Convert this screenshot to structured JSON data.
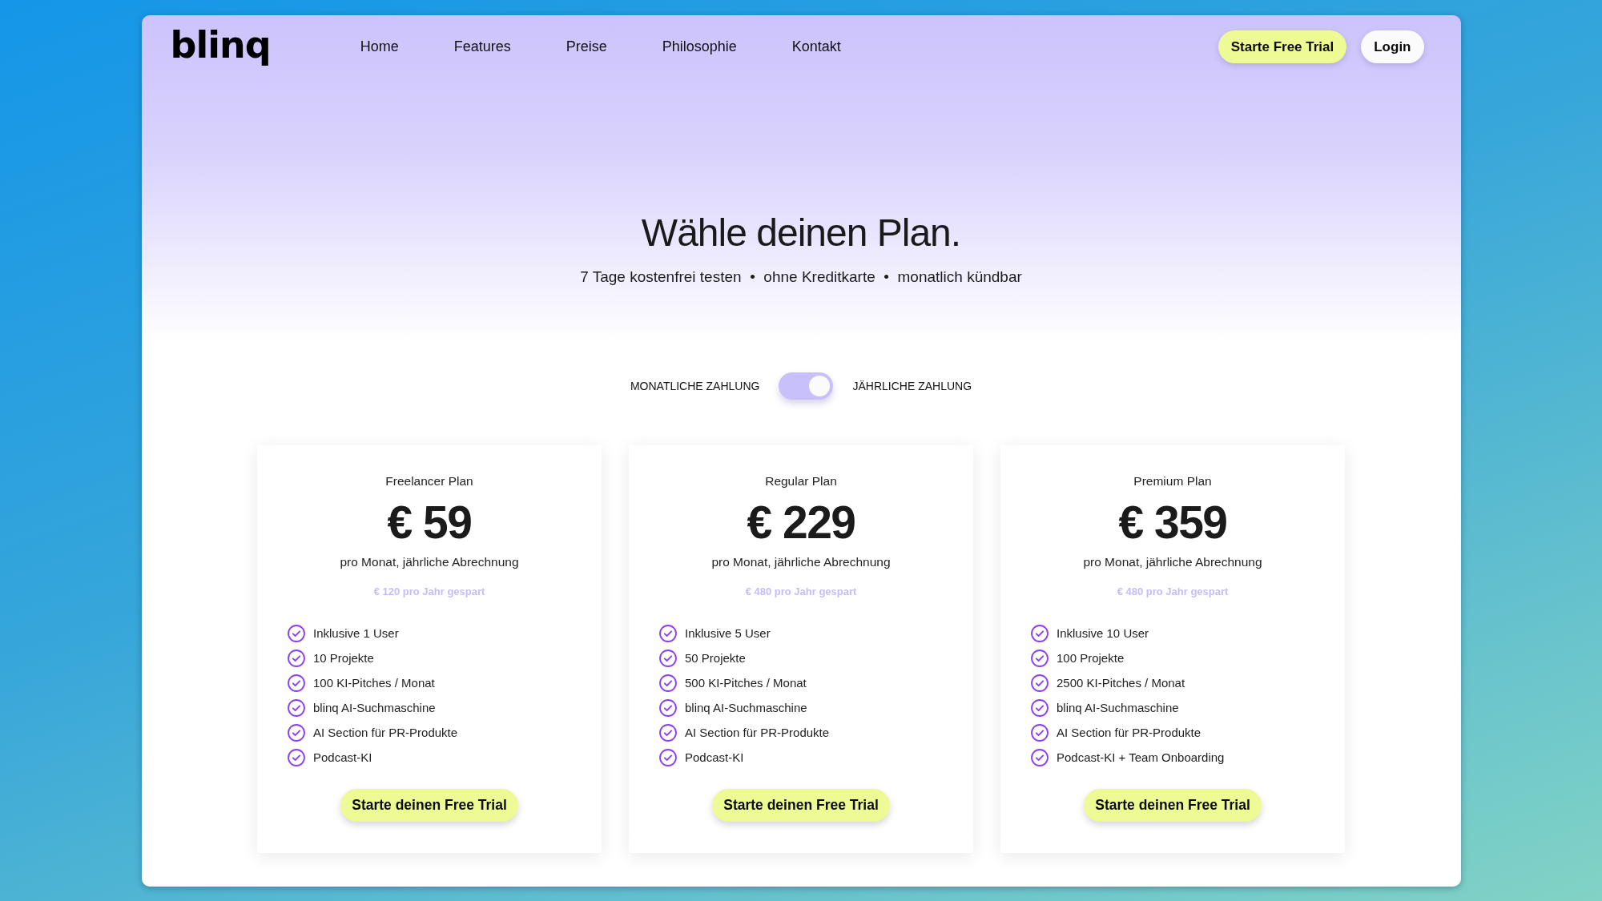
{
  "header": {
    "logo": "blinq",
    "nav": [
      {
        "label": "Home"
      },
      {
        "label": "Features"
      },
      {
        "label": "Preise"
      },
      {
        "label": "Philosophie"
      },
      {
        "label": "Kontakt"
      }
    ],
    "actions": [
      {
        "label": "Starte Free Trial",
        "kind": "primary"
      },
      {
        "label": "Login",
        "kind": "secondary"
      }
    ]
  },
  "hero": {
    "title": "Wähle deinen Plan.",
    "subtitle": "7 Tage kostenfrei testen  •  ohne Kreditkarte  •  monatlich kündbar"
  },
  "billing_toggle": {
    "left_label": "MONATLICHE ZAHLUNG",
    "right_label": "JÄHRLICHE ZAHLUNG",
    "on": true
  },
  "plans": [
    {
      "name": "Freelancer Plan",
      "price": "€ 59",
      "billing_note": "pro Monat, jährliche Abrechnung",
      "savings": "€ 120 pro Jahr gespart",
      "features": [
        "Inklusive 1 User",
        "10 Projekte",
        "100 KI-Pitches / Monat",
        "blinq AI-Suchmaschine",
        "AI Section für PR-Produkte",
        "Podcast-KI"
      ],
      "cta": "Starte deinen Free Trial"
    },
    {
      "name": "Regular Plan",
      "price": "€ 229",
      "billing_note": "pro Monat, jährliche Abrechnung",
      "savings": "€ 480 pro Jahr gespart",
      "features": [
        "Inklusive 5 User",
        "50 Projekte",
        "500 KI-Pitches / Monat",
        "blinq AI-Suchmaschine",
        "AI Section für PR-Produkte",
        "Podcast-KI"
      ],
      "cta": "Starte deinen Free Trial"
    },
    {
      "name": "Premium Plan",
      "price": "€ 359",
      "billing_note": "pro Monat, jährliche Abrechnung",
      "savings": "€ 480 pro Jahr gespart",
      "features": [
        "Inklusive 10 User",
        "100 Projekte",
        "2500 KI-Pitches / Monat",
        "blinq AI-Suchmaschine",
        "AI Section für PR-Produkte",
        "Podcast-KI + Team Onboarding"
      ],
      "cta": "Starte deinen Free Trial"
    }
  ]
}
